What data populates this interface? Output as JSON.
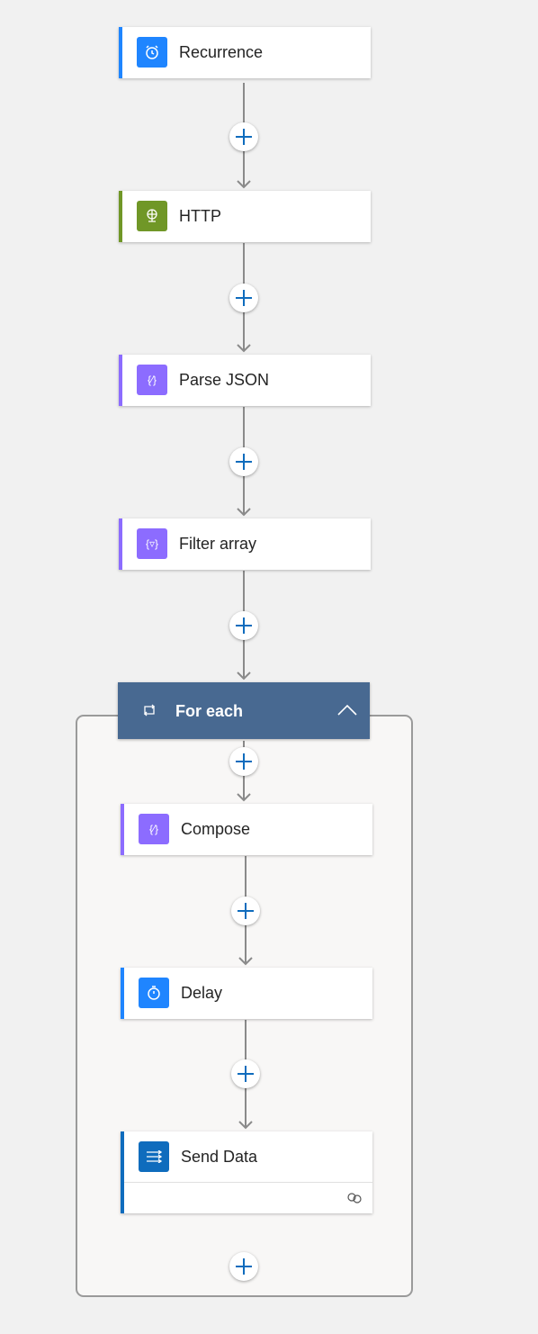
{
  "actions": {
    "recurrence": {
      "label": "Recurrence",
      "icon": "alarm-clock-icon",
      "color": "#1f85ff"
    },
    "http": {
      "label": "HTTP",
      "icon": "globe-icon",
      "color": "#709727"
    },
    "parse_json": {
      "label": "Parse JSON",
      "icon": "braces-icon",
      "color": "#8c6cff"
    },
    "filter_array": {
      "label": "Filter array",
      "icon": "braces-filter-icon",
      "color": "#8c6cff"
    },
    "for_each": {
      "label": "For each",
      "icon": "loop-icon",
      "color": "#486991"
    },
    "compose": {
      "label": "Compose",
      "icon": "braces-icon",
      "color": "#8c6cff"
    },
    "delay": {
      "label": "Delay",
      "icon": "timer-icon",
      "color": "#1f85ff"
    },
    "send_data": {
      "label": "Send Data",
      "icon": "send-data-icon",
      "color": "#0f6cbd"
    }
  },
  "colors": {
    "plus": "#0f6cbd",
    "connector": "#8a8a8a"
  }
}
